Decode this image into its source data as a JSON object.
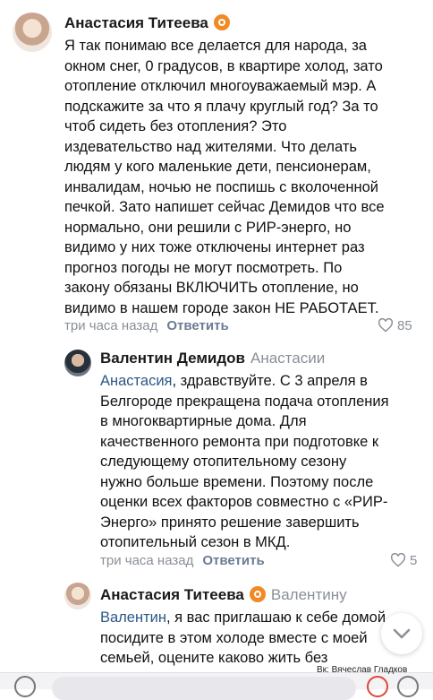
{
  "comments": [
    {
      "author": "Анастасия Титеева",
      "lines": [
        "Я так понимаю все делается для народа, за",
        "окном снег, 0 градусов, в квартире холод, зато",
        "отопление отключил многоуважаемый мэр. А",
        "подскажите за что я плачу круглый год? За то",
        "чтоб сидеть без отопления? Это",
        "издевательство над жителями. Что делать",
        "людям у кого маленькие дети, пенсионерам,",
        "инвалидам, ночью не поспишь с вколоченной",
        "печкой. Зато напишет сейчас Демидов что все",
        "нормально, они решили с РИР-энерго, но",
        "видимо у них тоже отключены интернет раз",
        "прогноз погоды не могут посмотреть.  По",
        "закону обязаны ВКЛЮЧИТЬ отопление, но",
        "видимо в нашем городе закон НЕ РАБОТАЕТ."
      ],
      "time": "три часа назад",
      "reply_label": "Ответить",
      "likes": "85"
    },
    {
      "author": "Валентин Демидов",
      "reply_to": "Анастасии",
      "mention": "Анастасия",
      "first_line_rest": ", здравствуйте. С 3 апреля в",
      "lines": [
        "Белгороде прекращена подача отопления",
        "в многоквартирные дома. Для",
        "качественного ремонта при подготовке к",
        "следующему отопительному сезону",
        "нужно больше времени. Поэтому после",
        "оценки всех факторов совместно с «РИР-",
        "Энерго» принято решение завершить",
        "отопительный сезон в МКД."
      ],
      "time": "три часа назад",
      "reply_label": "Ответить",
      "likes": "5"
    },
    {
      "author": "Анастасия Титеева",
      "reply_to": "Валентину",
      "mention": "Валентин",
      "first_line_rest": ", я вас приглашаю к себе домой",
      "lines": [
        "посидите в этом холоде вместе с моей",
        "семьей, оцените каково жить без"
      ]
    }
  ],
  "watermark": "Вк: Вячеслав Гладков",
  "icons": {
    "badge": "verified-badge-icon",
    "heart": "heart-icon",
    "scroll": "chevron-down-icon"
  },
  "colors": {
    "mention": "#2a5885",
    "badge": "#f08a24",
    "meta": "#8a8f98"
  }
}
